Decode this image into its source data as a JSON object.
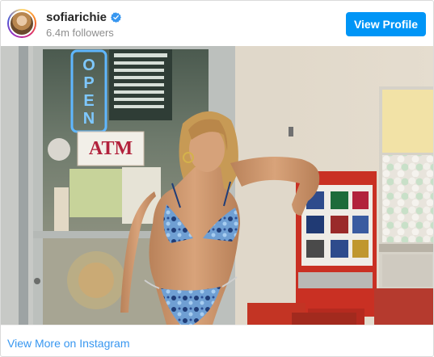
{
  "header": {
    "username": "sofiarichie",
    "followers": "6.4m followers",
    "view_profile_label": "View Profile",
    "verified": true
  },
  "photo": {
    "alt": "Instagram post photo"
  },
  "footer": {
    "more_link_label": "View More on Instagram"
  },
  "colors": {
    "accent": "#0095f6",
    "link": "#3897f0",
    "verified": "#3897f0"
  }
}
